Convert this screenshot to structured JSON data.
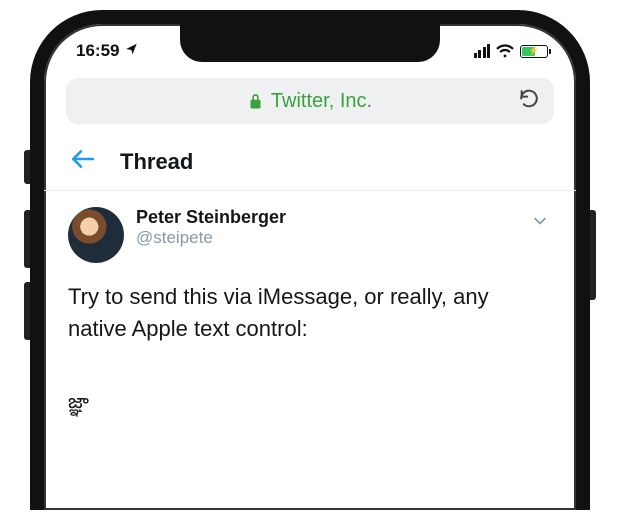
{
  "status_bar": {
    "time": "16:59",
    "location_icon": "location-arrow-icon",
    "signal_icon": "signal-bars-icon",
    "wifi_icon": "wifi-icon",
    "battery_icon": "battery-charging-icon"
  },
  "browser": {
    "lock_icon": "lock-icon",
    "site_name": "Twitter, Inc.",
    "reload_icon": "reload-icon"
  },
  "nav": {
    "back_icon": "back-arrow-icon",
    "title": "Thread"
  },
  "tweet": {
    "avatar": "avatar-photo",
    "display_name": "Peter Steinberger",
    "handle": "@steipete",
    "menu_icon": "chevron-down-icon",
    "body": "Try to send this via iMessage, or really, any native Apple text control:",
    "special_text": "జ్ఞ‌ా"
  }
}
